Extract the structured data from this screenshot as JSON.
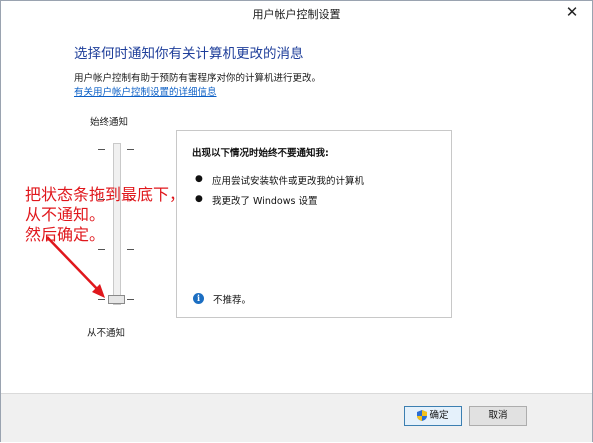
{
  "window": {
    "title": "用户帐户控制设置",
    "close_glyph": "✕"
  },
  "content": {
    "heading": "选择何时通知你有关计算机更改的消息",
    "description": "用户帐户控制有助于预防有害程序对你的计算机进行更改。",
    "link": "有关用户帐户控制设置的详细信息"
  },
  "slider": {
    "top_label": "始终通知",
    "bottom_label": "从不通知",
    "levels": 4,
    "selected_level": 1
  },
  "panel": {
    "title": "出现以下情况时始终不要通知我:",
    "items": [
      "应用尝试安装软件或更改我的计算机",
      "我更改了 Windows 设置"
    ],
    "bullet": "●",
    "info_icon": "info-icon",
    "info_glyph": "i",
    "note": "不推荐。"
  },
  "annotation": {
    "text": "把状态条拖到最底下，\n从不通知。\n然后确定。",
    "color": "#e0171c"
  },
  "buttons": {
    "ok": "确定",
    "cancel": "取消"
  },
  "colors": {
    "heading": "#1e3e9a",
    "link": "#0b5fc6",
    "annotation": "#e0171c",
    "info": "#1b6ec2"
  }
}
